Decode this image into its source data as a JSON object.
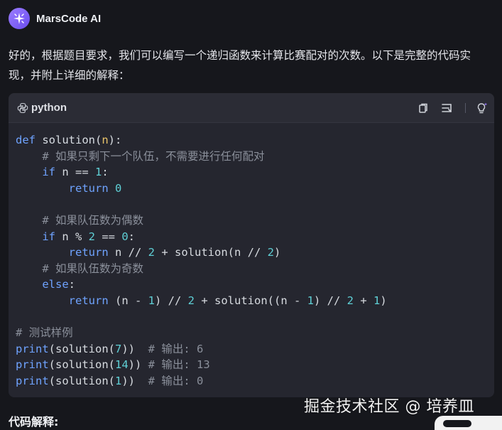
{
  "header": {
    "app_name": "MarsCode AI",
    "avatar_icon": "sparkle-icon"
  },
  "intro_text": "好的，根据题目要求，我们可以编写一个递归函数来计算比赛配对的次数。以下是完整的代码实现，并附上详细的解释：",
  "code_block": {
    "language": "python",
    "actions": [
      "copy-icon",
      "insert-icon",
      "ai-bulb-icon"
    ],
    "lines": [
      [
        [
          "kw",
          "def "
        ],
        [
          "fn",
          "solution"
        ],
        [
          "",
          "("
        ],
        [
          "pa",
          "n"
        ],
        [
          "",
          "):"
        ]
      ],
      [
        [
          "cm",
          "    # 如果只剩下一个队伍，不需要进行任何配对"
        ]
      ],
      [
        [
          "kw",
          "    if "
        ],
        [
          "",
          "n == "
        ],
        [
          "num",
          "1"
        ],
        [
          "",
          ":"
        ]
      ],
      [
        [
          "kw",
          "        return "
        ],
        [
          "num",
          "0"
        ]
      ],
      [
        [
          "",
          ""
        ]
      ],
      [
        [
          "cm",
          "    # 如果队伍数为偶数"
        ]
      ],
      [
        [
          "kw",
          "    if "
        ],
        [
          "",
          "n % "
        ],
        [
          "num",
          "2"
        ],
        [
          "",
          " == "
        ],
        [
          "num",
          "0"
        ],
        [
          "",
          ":"
        ]
      ],
      [
        [
          "kw",
          "        return "
        ],
        [
          "",
          "n // "
        ],
        [
          "num",
          "2"
        ],
        [
          "",
          " + solution(n // "
        ],
        [
          "num",
          "2"
        ],
        [
          "",
          ")"
        ]
      ],
      [
        [
          "cm",
          "    # 如果队伍数为奇数"
        ]
      ],
      [
        [
          "kw",
          "    else"
        ],
        [
          "",
          ":"
        ]
      ],
      [
        [
          "kw",
          "        return "
        ],
        [
          "",
          "(n - "
        ],
        [
          "num",
          "1"
        ],
        [
          "",
          ") // "
        ],
        [
          "num",
          "2"
        ],
        [
          "",
          " + solution((n - "
        ],
        [
          "num",
          "1"
        ],
        [
          "",
          ") // "
        ],
        [
          "num",
          "2"
        ],
        [
          "",
          " + "
        ],
        [
          "num",
          "1"
        ],
        [
          "",
          ")"
        ]
      ],
      [
        [
          "",
          ""
        ]
      ],
      [
        [
          "cm",
          "# 测试样例"
        ]
      ],
      [
        [
          "kw",
          "print"
        ],
        [
          "",
          "(solution("
        ],
        [
          "num",
          "7"
        ],
        [
          "",
          "))  "
        ],
        [
          "cm",
          "# 输出: 6"
        ]
      ],
      [
        [
          "kw",
          "print"
        ],
        [
          "",
          "(solution("
        ],
        [
          "num",
          "14"
        ],
        [
          "",
          ")) "
        ],
        [
          "cm",
          "# 输出: 13"
        ]
      ],
      [
        [
          "kw",
          "print"
        ],
        [
          "",
          "(solution("
        ],
        [
          "num",
          "1"
        ],
        [
          "",
          "))  "
        ],
        [
          "cm",
          "# 输出: 0"
        ]
      ]
    ]
  },
  "watermark": "掘金技术社区 @ 培养皿",
  "section_title": "代码解释:"
}
